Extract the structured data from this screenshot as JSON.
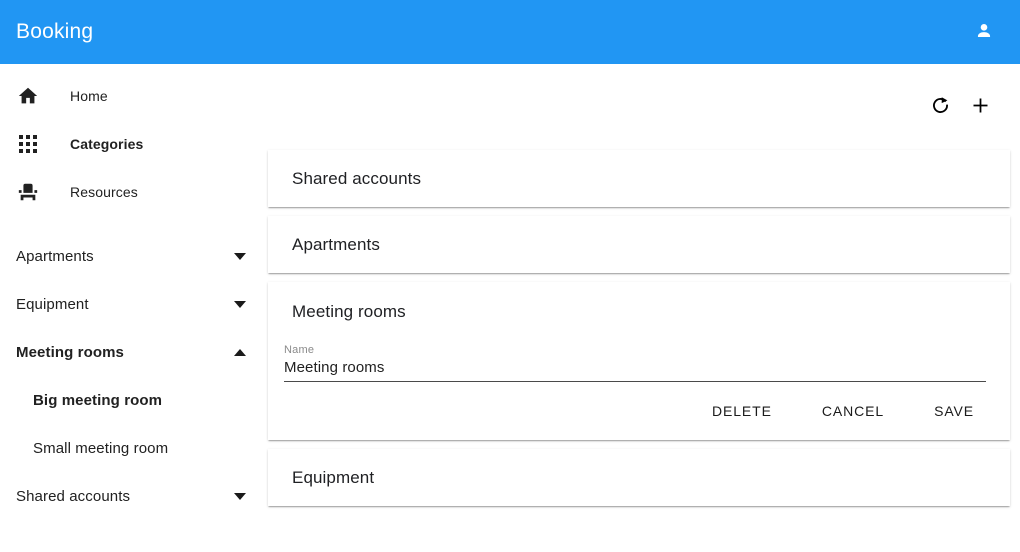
{
  "app": {
    "title": "Booking",
    "brand_color": "#2196f3",
    "account_icon": "person-icon"
  },
  "sidebar": {
    "nav": [
      {
        "label": "Home",
        "icon": "home-icon",
        "active": false
      },
      {
        "label": "Categories",
        "icon": "apps-grid-icon",
        "active": true
      },
      {
        "label": "Resources",
        "icon": "event-seat-icon",
        "active": false
      }
    ],
    "categories": [
      {
        "label": "Apartments",
        "expanded": false,
        "chevron": "chevron-down-icon",
        "children": []
      },
      {
        "label": "Equipment",
        "expanded": false,
        "chevron": "chevron-down-icon",
        "children": []
      },
      {
        "label": "Meeting rooms",
        "expanded": true,
        "chevron": "chevron-up-icon",
        "children": [
          {
            "label": "Big meeting room",
            "active": true
          },
          {
            "label": "Small meeting room",
            "active": false
          }
        ]
      },
      {
        "label": "Shared accounts",
        "expanded": false,
        "chevron": "chevron-down-icon",
        "children": []
      }
    ]
  },
  "toolbar": {
    "refresh_icon": "refresh-icon",
    "add_icon": "plus-icon"
  },
  "main": {
    "panels": [
      {
        "title": "Shared accounts",
        "expanded": false
      },
      {
        "title": "Apartments",
        "expanded": false
      },
      {
        "title": "Meeting rooms",
        "expanded": true,
        "form": {
          "name_label": "Name",
          "name_value": "Meeting rooms",
          "name_placeholder": "Name"
        },
        "actions": {
          "delete_label": "DELETE",
          "cancel_label": "CANCEL",
          "save_label": "SAVE"
        }
      },
      {
        "title": "Equipment",
        "expanded": false
      }
    ]
  }
}
